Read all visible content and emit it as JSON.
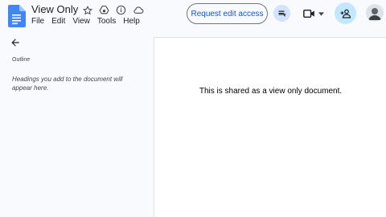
{
  "header": {
    "title": "View Only",
    "menus": [
      "File",
      "Edit",
      "View",
      "Tools",
      "Help"
    ],
    "request_edit_label": "Request edit access",
    "icons": [
      "star-icon",
      "move-to-drive-icon",
      "info-icon",
      "cloud-status-icon"
    ]
  },
  "sidebar": {
    "outline_label": "Outline",
    "outline_hint": "Headings you add to the document will appear here."
  },
  "document": {
    "body_text": "This is shared as a view only document."
  },
  "colors": {
    "accent": "#0b57d0",
    "docs_blue": "#4285f4",
    "share_bg": "#c2e7ff",
    "comments_bg": "#d3e3fd"
  }
}
